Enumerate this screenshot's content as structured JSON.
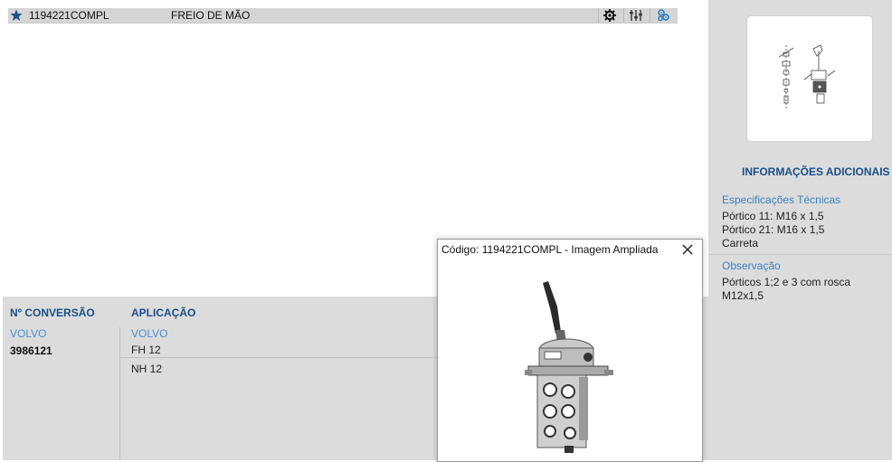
{
  "product": {
    "code": "1194221COMPL",
    "description": "FREIO DE MÃO",
    "icons": [
      "star-icon",
      "gear-icon",
      "settings-sliders-icon",
      "gears-cluster-icon"
    ]
  },
  "sidebar": {
    "info_title": "INFORMAÇÕES ADICIONAIS",
    "spec_heading": "Especificações Técnicas",
    "spec_lines": [
      "Pórtico 11: M16 x 1,5",
      "Pórtico 21: M16 x 1,5",
      "Carreta"
    ],
    "obs_heading": "Observação",
    "obs_lines": [
      "Pórticos 1;2 e 3 com rosca",
      "M12x1,5"
    ]
  },
  "bottom": {
    "conversion_heading": "Nº CONVERSÃO",
    "conversion_brand": "VOLVO",
    "conversion_number": "3986121",
    "application_heading": "APLICAÇÃO",
    "application_brand": "VOLVO",
    "applications": [
      "FH 12",
      "NH 12"
    ]
  },
  "modal": {
    "title": "Código: 1194221COMPL - Imagem Ampliada",
    "close_icon": "close-icon"
  },
  "colors": {
    "heading_blue": "#1b4f8a",
    "link_blue": "#3c83c3",
    "panel_gray": "#dcdcdc"
  }
}
